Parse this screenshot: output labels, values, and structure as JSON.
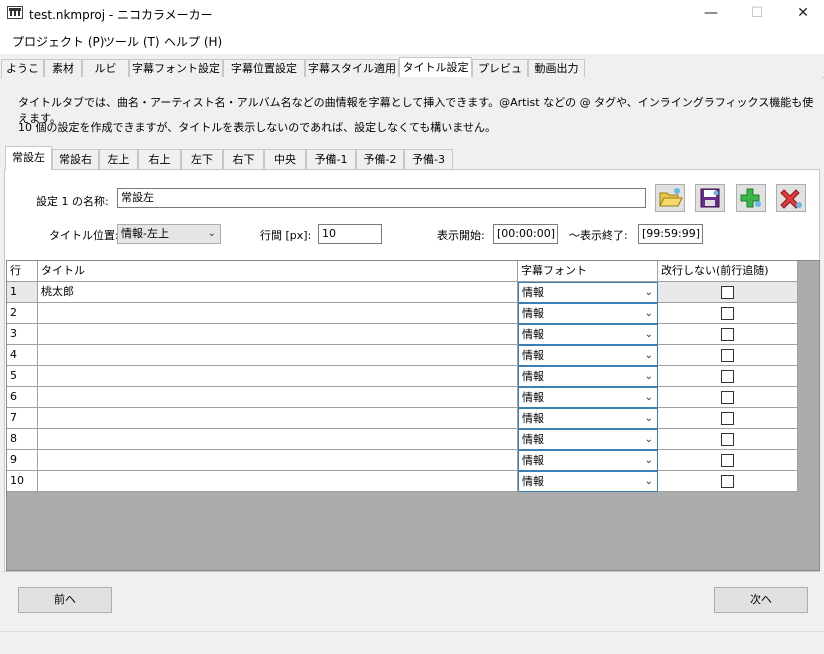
{
  "window": {
    "title": "test.nkmproj - ニコカラメーカー",
    "minimize": "—",
    "maximize": "☐",
    "close": "✕"
  },
  "menu": [
    "プロジェクト (P)",
    "ツール (T)",
    "ヘルプ (H)"
  ],
  "main_tabs": [
    "ようこそ",
    "素材",
    "ルビ",
    "字幕フォント設定",
    "字幕位置設定",
    "字幕スタイル適用",
    "タイトル設定",
    "プレビュー",
    "動画出力"
  ],
  "active_main_tab": "タイトル設定",
  "description": {
    "line1": "タイトルタブでは、曲名・アーティスト名・アルバム名などの曲情報を字幕として挿入できます。@Artist などの @ タグや、インライングラフィックス機能も使えます。",
    "line2": "10 個の設定を作成できますが、タイトルを表示しないのであれば、設定しなくても構いません。"
  },
  "sub_tabs": [
    "常設左",
    "常設右",
    "左上",
    "右上",
    "左下",
    "右下",
    "中央",
    "予備-1",
    "予備-2",
    "予備-3"
  ],
  "active_sub_tab": "常設左",
  "settings": {
    "name_label": "設定 1 の名称:",
    "name_value": "常設左",
    "position_label": "タイトル位置:",
    "position_value": "情報-左上",
    "line_spacing_label": "行間 [px]:",
    "line_spacing_value": "10",
    "start_label": "表示開始:",
    "start_value": "[00:00:00]",
    "end_label": "〜表示終了:",
    "end_value": "[99:59:99]"
  },
  "toolbar_icons": [
    "open-folder-icon",
    "save-icon",
    "add-icon",
    "delete-icon"
  ],
  "grid": {
    "headers": {
      "row": "行",
      "title": "タイトル",
      "font": "字幕フォント",
      "nobreak": "改行しない(前行追随)"
    },
    "rows": [
      {
        "num": "1",
        "title": "桃太郎",
        "font": "情報"
      },
      {
        "num": "2",
        "title": "",
        "font": "情報"
      },
      {
        "num": "3",
        "title": "",
        "font": "情報"
      },
      {
        "num": "4",
        "title": "",
        "font": "情報"
      },
      {
        "num": "5",
        "title": "",
        "font": "情報"
      },
      {
        "num": "6",
        "title": "",
        "font": "情報"
      },
      {
        "num": "7",
        "title": "",
        "font": "情報"
      },
      {
        "num": "8",
        "title": "",
        "font": "情報"
      },
      {
        "num": "9",
        "title": "",
        "font": "情報"
      },
      {
        "num": "10",
        "title": "",
        "font": "情報"
      }
    ]
  },
  "footer": {
    "prev": "前へ",
    "next": "次へ"
  }
}
